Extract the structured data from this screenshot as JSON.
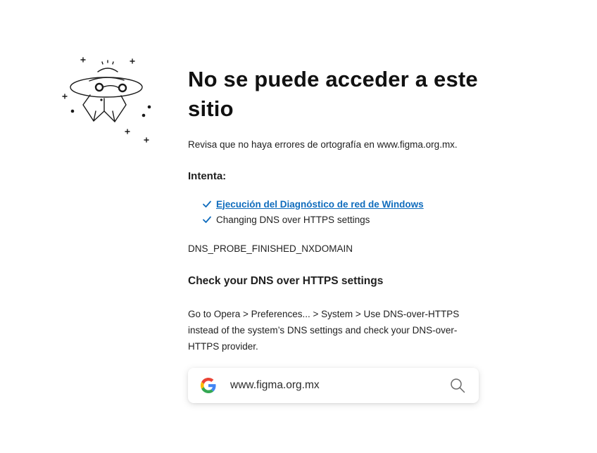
{
  "page": {
    "title": "No se puede acceder a este sitio",
    "hint": "Revisa que no haya errores de ortografía en www.figma.org.mx.",
    "try_heading": "Intenta:",
    "suggestions": [
      {
        "label": "Ejecución del Diagnóstico de red de Windows",
        "type": "link"
      },
      {
        "label": "Changing DNS over HTTPS settings",
        "type": "text"
      }
    ],
    "error_code": "DNS_PROBE_FINISHED_NXDOMAIN",
    "dns_heading": "Check your DNS over HTTPS settings",
    "dns_body": "Go to Opera > Preferences... > System > Use DNS-over-HTTPS instead of the system’s DNS settings and check your DNS-over-HTTPS provider."
  },
  "search": {
    "value": "www.figma.org.mx",
    "engine_icon": "google-g-icon",
    "action_icon": "search-icon"
  },
  "colors": {
    "link": "#0f6cbd",
    "check": "#0f6cbd",
    "text": "#1f1f1f"
  }
}
